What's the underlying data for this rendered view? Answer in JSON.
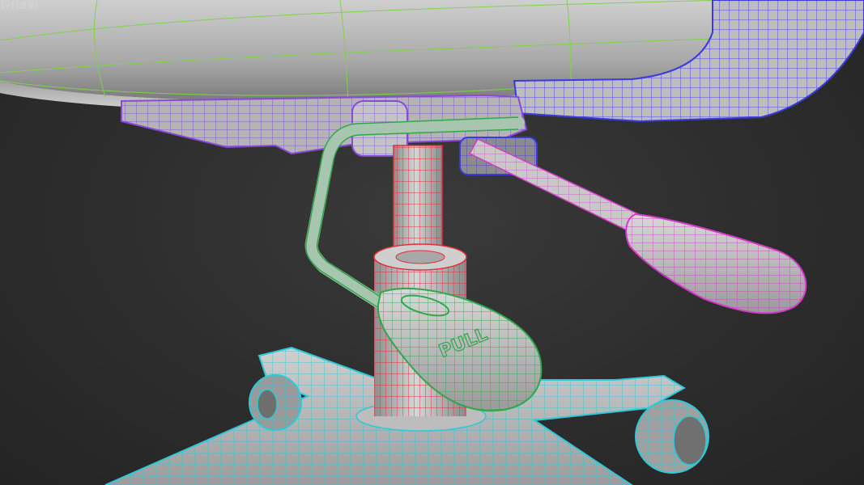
{
  "viewport": {
    "label": "[+] [透视]"
  },
  "lever_paddle": {
    "text": "PULL"
  },
  "colors": {
    "background": "#2b2b2b",
    "seat_wire": "#7fd24a",
    "bracket_wire": "#8a4ad8",
    "armrest_wire": "#3a3adf",
    "gas_cylinder_wire": "#e0303a",
    "tilt_lever_wire": "#2ea84a",
    "height_lever_wire": "#d23ac8",
    "base_wire": "#2ec8d8",
    "surface": "#b8b8b8"
  },
  "icons": {
    "viewport_menu": "plus-bracket-icon"
  }
}
